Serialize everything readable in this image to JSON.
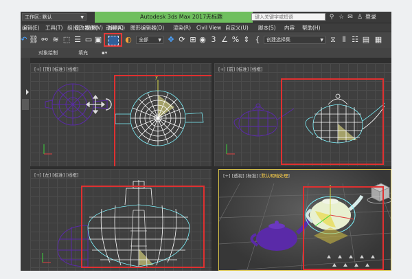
{
  "titlebar": {
    "workspace_label": "工作区: 默认",
    "app_title": "Autodesk 3ds Max 2017",
    "doc_title": "无标题",
    "search_placeholder": "键入关键字或短语",
    "login": "登录"
  },
  "menu": [
    "编辑(E)",
    "工具(T)",
    "组(G)",
    "视图(V)",
    "创建(C)",
    "修改器(M)",
    "动画(A)",
    "图形编辑器(D)",
    "渲染(R)",
    "Civil View",
    "自定义(U)",
    "脚本(S)",
    "内容",
    "帮助(H)"
  ],
  "toolbar": {
    "filter_value": "全部",
    "view_value": "视图",
    "selection_set_placeholder": "创建选择集"
  },
  "ribbon": {
    "tab_object_paint": "对象绘制",
    "tab_populate": "填充"
  },
  "viewports": {
    "top": "[+] [顶] [标准] [线框]",
    "front": "[+] [前] [标准] [线框]",
    "left": "[+] [左] [标准] [线框]",
    "persp_prefix": "[+] [透视] [标准] [",
    "persp_active": "默认明暗处理",
    "persp_suffix": "]"
  },
  "colors": {
    "highlight_red": "#e03030",
    "title_green": "#6fbf5e",
    "teapot_purple": "#5a2aa8",
    "selection_cyan": "#7ff5ff"
  }
}
